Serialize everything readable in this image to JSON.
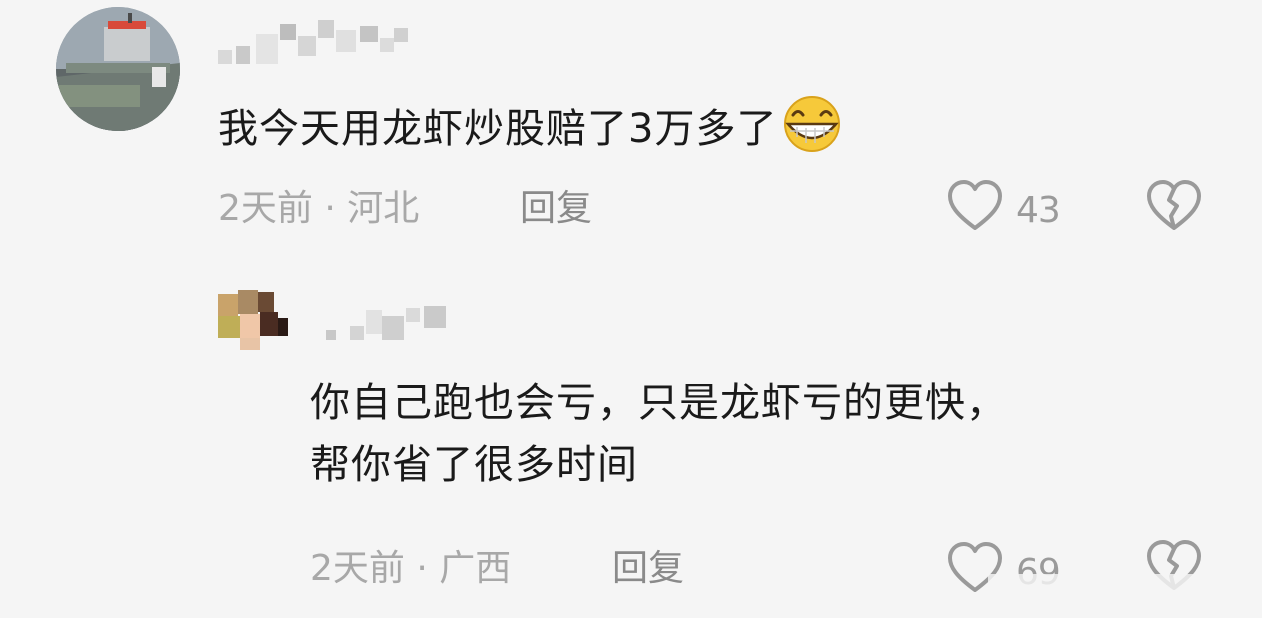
{
  "top_comment": {
    "text": "我今天用龙虾炒股赔了3万多了",
    "emoji": "grin-emoji",
    "time": "2天前",
    "separator": "·",
    "location": "河北",
    "reply_label": "回复",
    "like_count": "43",
    "icons": {
      "like": "heart-outline-icon",
      "dislike": "broken-heart-icon"
    }
  },
  "reply_comment": {
    "text_line1": "你自己跑也会亏，只是龙虾亏的更快，",
    "text_line2": "帮你省了很多时间",
    "time": "2天前",
    "separator": "·",
    "location": "广西",
    "reply_label": "回复",
    "like_count": "69",
    "icons": {
      "like": "heart-outline-icon",
      "dislike": "broken-heart-icon"
    }
  },
  "colors": {
    "background": "#f5f5f5",
    "text": "#1a1a1a",
    "meta": "#a8a8a8",
    "emoji": "#f6c93a"
  }
}
